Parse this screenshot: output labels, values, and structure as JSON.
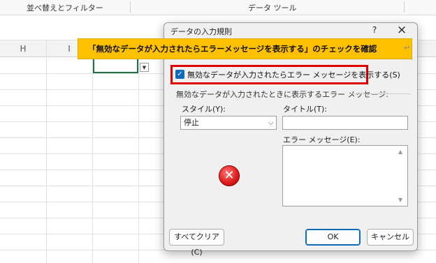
{
  "ribbon": {
    "sort_filter": "並べ替えとフィルター",
    "data_tools": "データ ツール"
  },
  "columns": [
    "H",
    "I"
  ],
  "dialog": {
    "title": "データの入力規則",
    "help": "?",
    "close": "×",
    "show_error_checkbox": {
      "label": "無効なデータが入力されたらエラー メッセージを表示する(S)",
      "checked": true
    },
    "section_label": "無効なデータが入力されたときに表示するエラー メッセージ:",
    "style": {
      "label": "スタイル(Y):",
      "value": "停止"
    },
    "title_field": {
      "label": "タイトル(T):",
      "value": ""
    },
    "message_field": {
      "label": "エラー メッセージ(E):",
      "value": ""
    },
    "error_icon": "stop-error-icon",
    "buttons": {
      "clear_all": "すべてクリア(C)",
      "ok": "OK",
      "cancel": "キャンセル"
    }
  },
  "callout": {
    "text": "「無効なデータが入力されたらエラーメッセージを表示する」のチェックを確認"
  },
  "colors": {
    "callout_bg": "#ffc000",
    "highlight_border": "#e00000",
    "checkbox": "#0f6cbd",
    "active_cell": "#1e7145"
  }
}
